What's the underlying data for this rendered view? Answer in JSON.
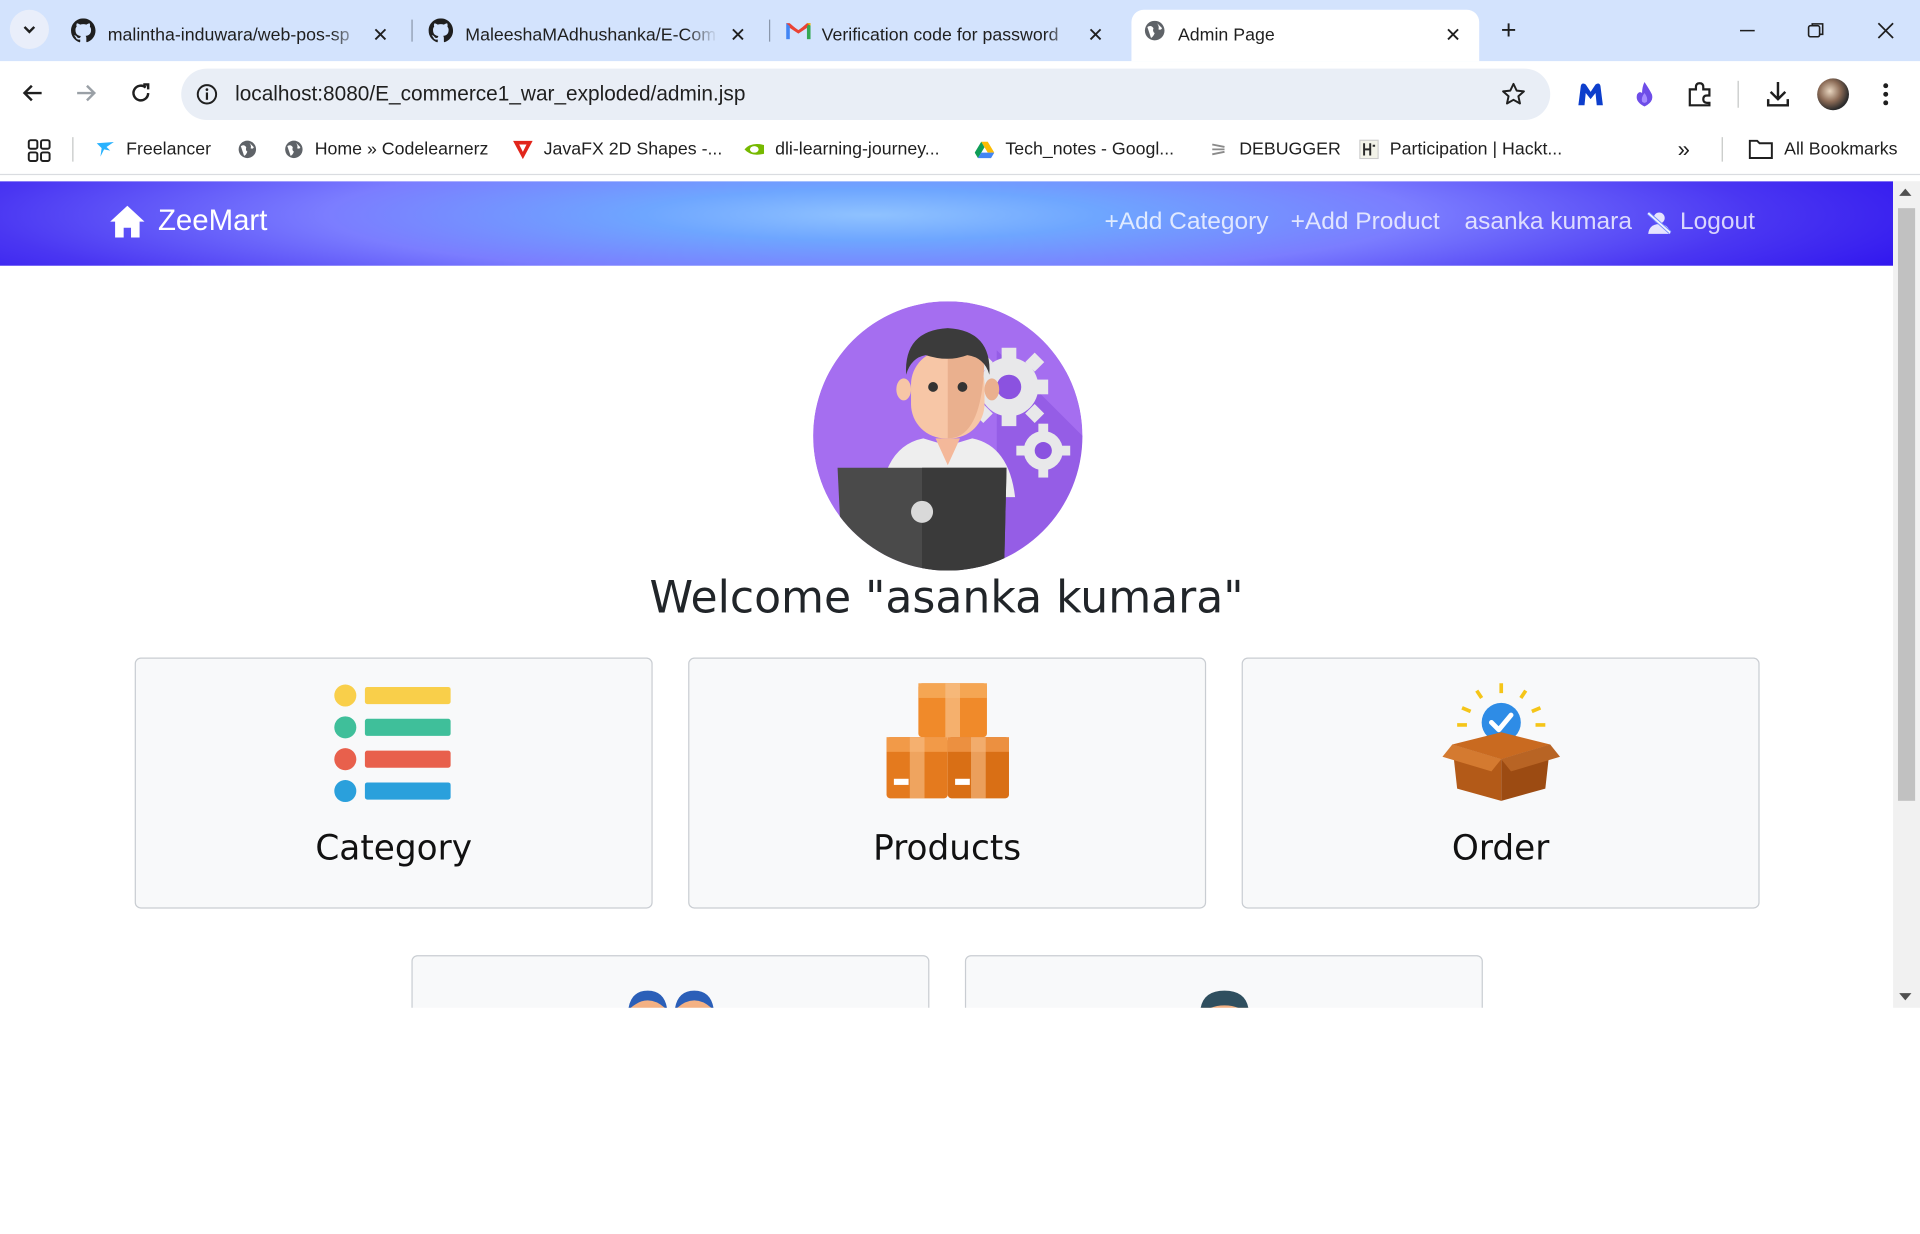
{
  "browser": {
    "tabs": [
      {
        "title": "malintha-induwara/web-pos-sp",
        "icon": "github-icon",
        "active": false
      },
      {
        "title": "MaleeshaMAdhushanka/E-Com",
        "icon": "github-icon",
        "active": false
      },
      {
        "title": "Verification code for password",
        "icon": "gmail-icon",
        "active": false
      },
      {
        "title": "Admin Page",
        "icon": "globe-icon",
        "active": true
      }
    ],
    "url": "localhost:8080/E_commerce1_war_exploded/admin.jsp",
    "bookmarks": [
      {
        "label": "Freelancer",
        "icon": "freelancer-icon"
      },
      {
        "label": "",
        "icon": "globe-icon"
      },
      {
        "label": "Home » Codelearnerz",
        "icon": "globe-icon"
      },
      {
        "label": "JavaFX 2D Shapes -...",
        "icon": "javafx-icon"
      },
      {
        "label": "dli-learning-journey...",
        "icon": "nvidia-icon"
      },
      {
        "label": "Tech_notes - Googl...",
        "icon": "google-drive-icon"
      },
      {
        "label": "DEBUGGER",
        "icon": "debugger-icon"
      },
      {
        "label": "Participation | Hackt...",
        "icon": "hackerrank-icon"
      }
    ],
    "all_bookmarks": "All Bookmarks"
  },
  "navbar": {
    "brand": "ZeeMart",
    "links": [
      "+Add Category",
      "+Add Product",
      "asanka kumara",
      "Logout"
    ]
  },
  "main": {
    "welcome": "Welcome \"asanka kumara\"",
    "cards": [
      "Category",
      "Products",
      "Order"
    ]
  },
  "colors": {
    "tab_strip": "#d3e3fd",
    "navbar_start": "#2f14ee",
    "navbar_center": "#8fc2ff",
    "avatar_bg": "#a56ef0",
    "card_bg": "#f8f9fa"
  }
}
